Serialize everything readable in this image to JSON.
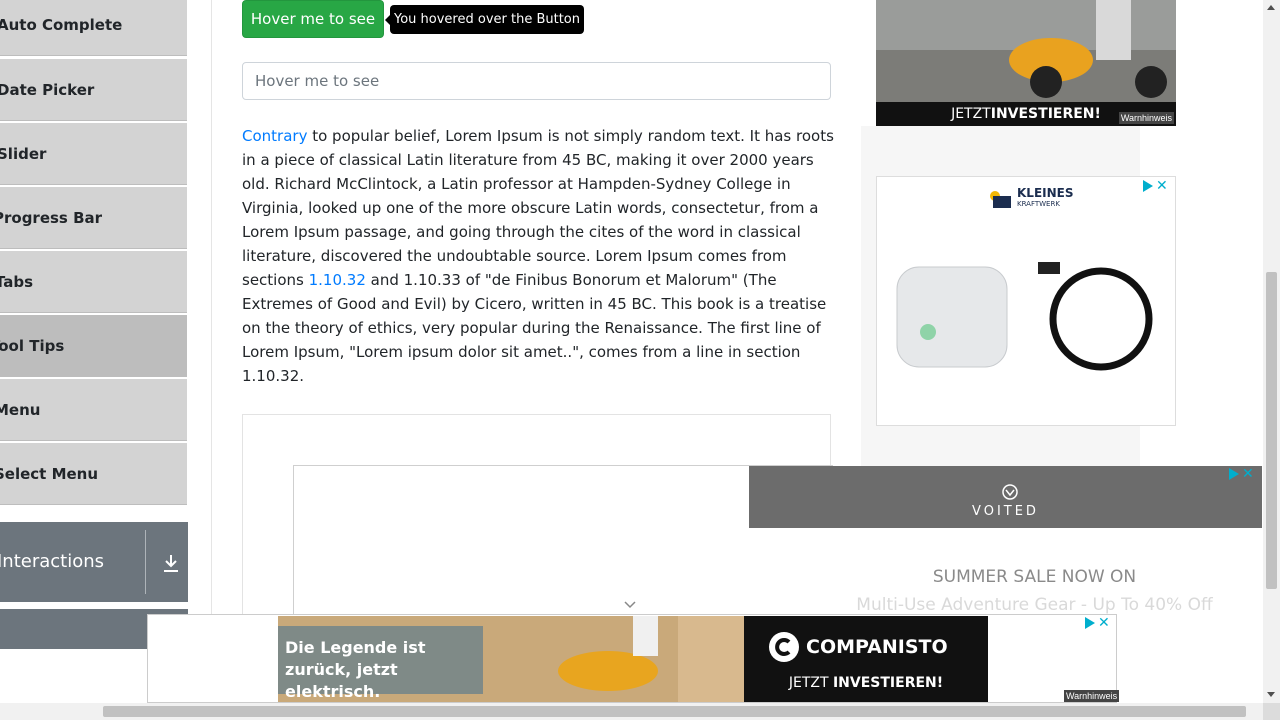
{
  "sidebar": {
    "items": [
      {
        "label": "Auto Complete"
      },
      {
        "label": "Date Picker"
      },
      {
        "label": "Slider"
      },
      {
        "label": "Progress Bar"
      },
      {
        "label": "Tabs"
      },
      {
        "label": "Tool Tips"
      },
      {
        "label": "Menu"
      },
      {
        "label": "Select Menu"
      }
    ],
    "active": "Tool Tips",
    "group": {
      "title": "Interactions"
    }
  },
  "main": {
    "hover_button_label": "Hover me to see",
    "tooltip_text": "You hovered over the Button",
    "text_field_placeholder": "Hover me to see",
    "paragraph": {
      "link1": "Contrary",
      "part1": " to popular belief, Lorem Ipsum is not simply random text. It has roots in a piece of classical Latin literature from 45 BC, making it over 2000 years old. Richard McClintock, a Latin professor at Hampden-Sydney College in Virginia, looked up one of the more obscure Latin words, consectetur, from a Lorem Ipsum passage, and going through the cites of the word in classical literature, discovered the undoubtable source. Lorem Ipsum comes from sections ",
      "link2": "1.10.32",
      "part2": " and 1.10.33 of \"de Finibus Bonorum et Malorum\" (The Extremes of Good and Evil) by Cicero, written in 45 BC. This book is a treatise on the theory of ethics, very popular during the Renaissance. The first line of Lorem Ipsum, \"Lorem ipsum dolor sit amet..\", comes from a line in section 1.10.32."
    }
  },
  "ads": {
    "top": {
      "cta_prefix": "JETZT ",
      "cta_bold": "INVESTIEREN!",
      "warning": "Warnhinweis"
    },
    "mid": {
      "brand_line1": "KLEINES",
      "brand_line2": "KRAFTWERK"
    },
    "voited": {
      "brand": "VOITED",
      "headline": "SUMMER SALE NOW ON",
      "subline": "Multi-Use Adventure Gear - Up To 40% Off"
    },
    "bottom": {
      "headline": "Die Legende ist zurück, jetzt elektrisch.",
      "brand": "COMPANISTO",
      "cta_prefix": "JETZT ",
      "cta_bold": "INVESTIEREN!",
      "warning": "Warnhinweis"
    }
  },
  "colors": {
    "sidebar_bg": "#d3d3d3",
    "active_bg": "#bdbdbd",
    "group_bg": "#6c757d",
    "success": "#28a745",
    "link": "#007bff"
  }
}
